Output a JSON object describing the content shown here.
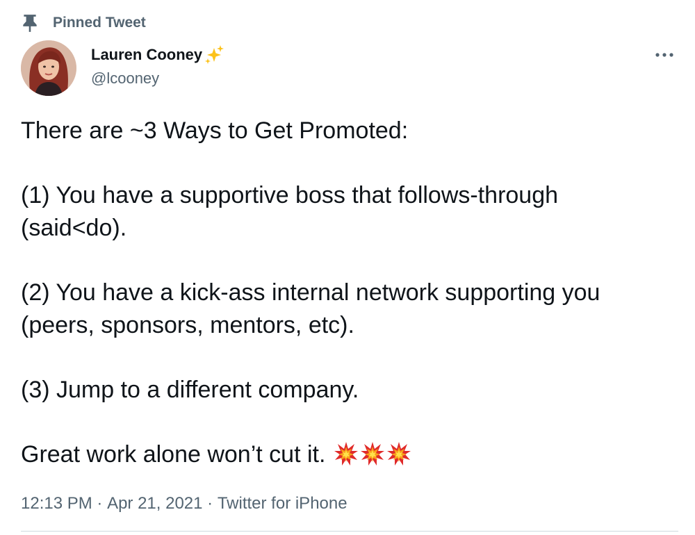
{
  "pinned": {
    "label": "Pinned Tweet",
    "icon": "pin-icon"
  },
  "author": {
    "display_name": "Lauren Cooney",
    "name_emoji": "sparkles-icon",
    "handle": "@lcooney",
    "avatar": "avatar"
  },
  "more": {
    "icon": "more-horizontal-icon"
  },
  "tweet": {
    "line1": "There are ~3 Ways to Get Promoted:",
    "line2": "(1) You have a supportive boss that follows-through",
    "line3": "(said<do).",
    "line4": "(2) You have a kick-ass internal network supporting you",
    "line5": "(peers, sponsors, mentors, etc).",
    "line6": "(3) Jump to a different company.",
    "line7": "Great work alone won’t cut it.",
    "trailing_emoji": [
      "collision-icon",
      "collision-icon",
      "collision-icon"
    ]
  },
  "meta": {
    "time": "12:13 PM",
    "date": "Apr 21, 2021",
    "separator": " · ",
    "source": "Twitter for iPhone"
  },
  "colors": {
    "text": "#0f1419",
    "secondary": "#536471",
    "divider": "#cfd9de"
  }
}
